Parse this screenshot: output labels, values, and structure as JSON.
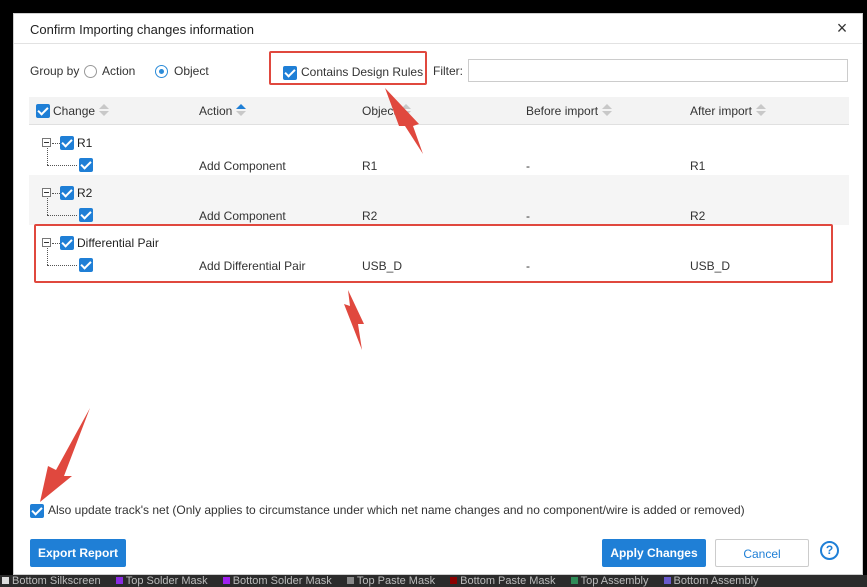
{
  "dialog": {
    "title": "Confirm Importing changes information",
    "close_label": "×"
  },
  "toolbar": {
    "group_by_label": "Group by",
    "radio_action_label": "Action",
    "radio_object_label": "Object",
    "radio_selected": "Object",
    "design_rules_label": "Contains Design Rules",
    "design_rules_checked": true,
    "filter_label": "Filter:",
    "filter_value": ""
  },
  "table": {
    "headers": {
      "change": "Change",
      "action": "Action",
      "object": "Object",
      "before": "Before import",
      "after": "After import"
    },
    "sort_column": "Action",
    "rows": [
      {
        "group": "R1",
        "action": "Add Component",
        "object": "R1",
        "before": "-",
        "after": "R1"
      },
      {
        "group": "R2",
        "action": "Add Component",
        "object": "R2",
        "before": "-",
        "after": "R2"
      },
      {
        "group": "Differential Pair",
        "action": "Add Differential Pair",
        "object": "USB_D",
        "before": "-",
        "after": "USB_D"
      }
    ]
  },
  "footer": {
    "update_track_label": "Also update track's net (Only applies to circumstance under which net name changes and no component/wire is added or removed)",
    "update_track_checked": true,
    "export_label": "Export Report",
    "apply_label": "Apply Changes",
    "cancel_label": "Cancel",
    "help_label": "?"
  },
  "background": {
    "layers": [
      "Bottom Silkscreen",
      "Top Solder Mask",
      "Bottom Solder Mask",
      "Top Paste Mask",
      "Bottom Paste Mask",
      "Top Assembly",
      "Bottom Assembly"
    ]
  },
  "colors": {
    "accent": "#1f7fd6",
    "highlight": "#e0483e"
  }
}
